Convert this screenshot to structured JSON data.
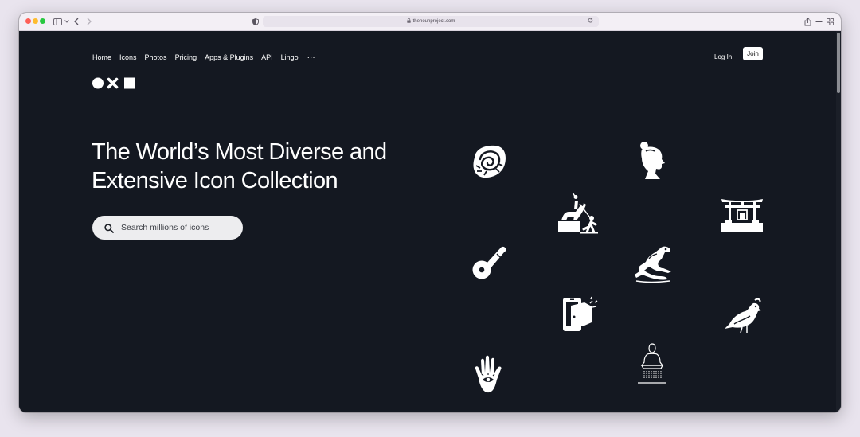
{
  "browser": {
    "url": "thenounproject.com",
    "icons": {
      "sidebar": "sidebar-icon",
      "back": "chevron-left-icon",
      "forward": "chevron-right-icon",
      "privacy": "shield-icon",
      "lock": "lock-icon",
      "reload": "reload-icon",
      "share": "share-icon",
      "new_tab": "plus-icon",
      "tabs": "tab-overview-icon"
    }
  },
  "nav": {
    "items": [
      "Home",
      "Icons",
      "Photos",
      "Pricing",
      "Apps & Plugins",
      "API",
      "Lingo"
    ],
    "more": "···",
    "login": "Log In",
    "join": "Join"
  },
  "hero": {
    "title_line1": "The World’s Most Diverse and",
    "title_line2": "Extensive Icon Collection",
    "search_placeholder": "Search millions of icons"
  },
  "showcase": {
    "icons": [
      "ammonite-fossil-icon",
      "woman-profile-icon",
      "equestrian-statue-icon",
      "torii-gate-icon",
      "pizza-cutter-icon",
      "lizard-icon",
      "phone-door-icon",
      "quail-bird-icon",
      "hamsa-hand-icon",
      "buddha-statue-icon"
    ]
  },
  "colors": {
    "background": "#141821",
    "text": "#ffffff",
    "search_bg": "#ededef"
  }
}
